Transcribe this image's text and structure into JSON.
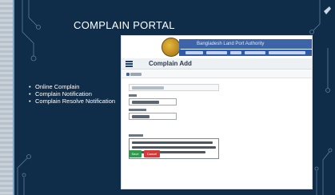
{
  "slide": {
    "title": "COMPLAIN PORTAL",
    "bullets": [
      "Online Complain",
      "Complain Notification",
      "Complain Resolve Notification"
    ]
  },
  "screenshot": {
    "org_name": "Bangladesh Land Port Authority",
    "page_title": "Complain Add",
    "buttons": {
      "save": "Save",
      "cancel": "Cancel"
    }
  },
  "colors": {
    "slide_bg": "#0f2d49",
    "header_blue": "#3d64a8",
    "save_green": "#2e9a4a",
    "cancel_red": "#d23a3a"
  }
}
